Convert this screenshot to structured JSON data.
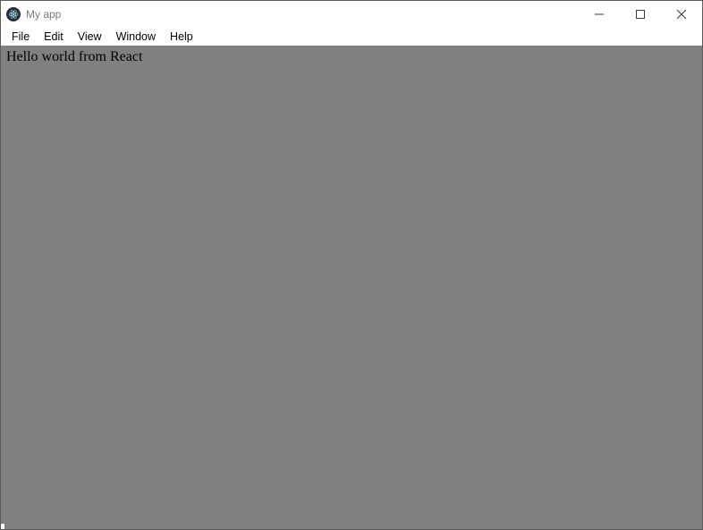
{
  "window": {
    "title": "My app"
  },
  "menubar": {
    "items": [
      {
        "label": "File"
      },
      {
        "label": "Edit"
      },
      {
        "label": "View"
      },
      {
        "label": "Window"
      },
      {
        "label": "Help"
      }
    ]
  },
  "content": {
    "text": "Hello world from React"
  }
}
